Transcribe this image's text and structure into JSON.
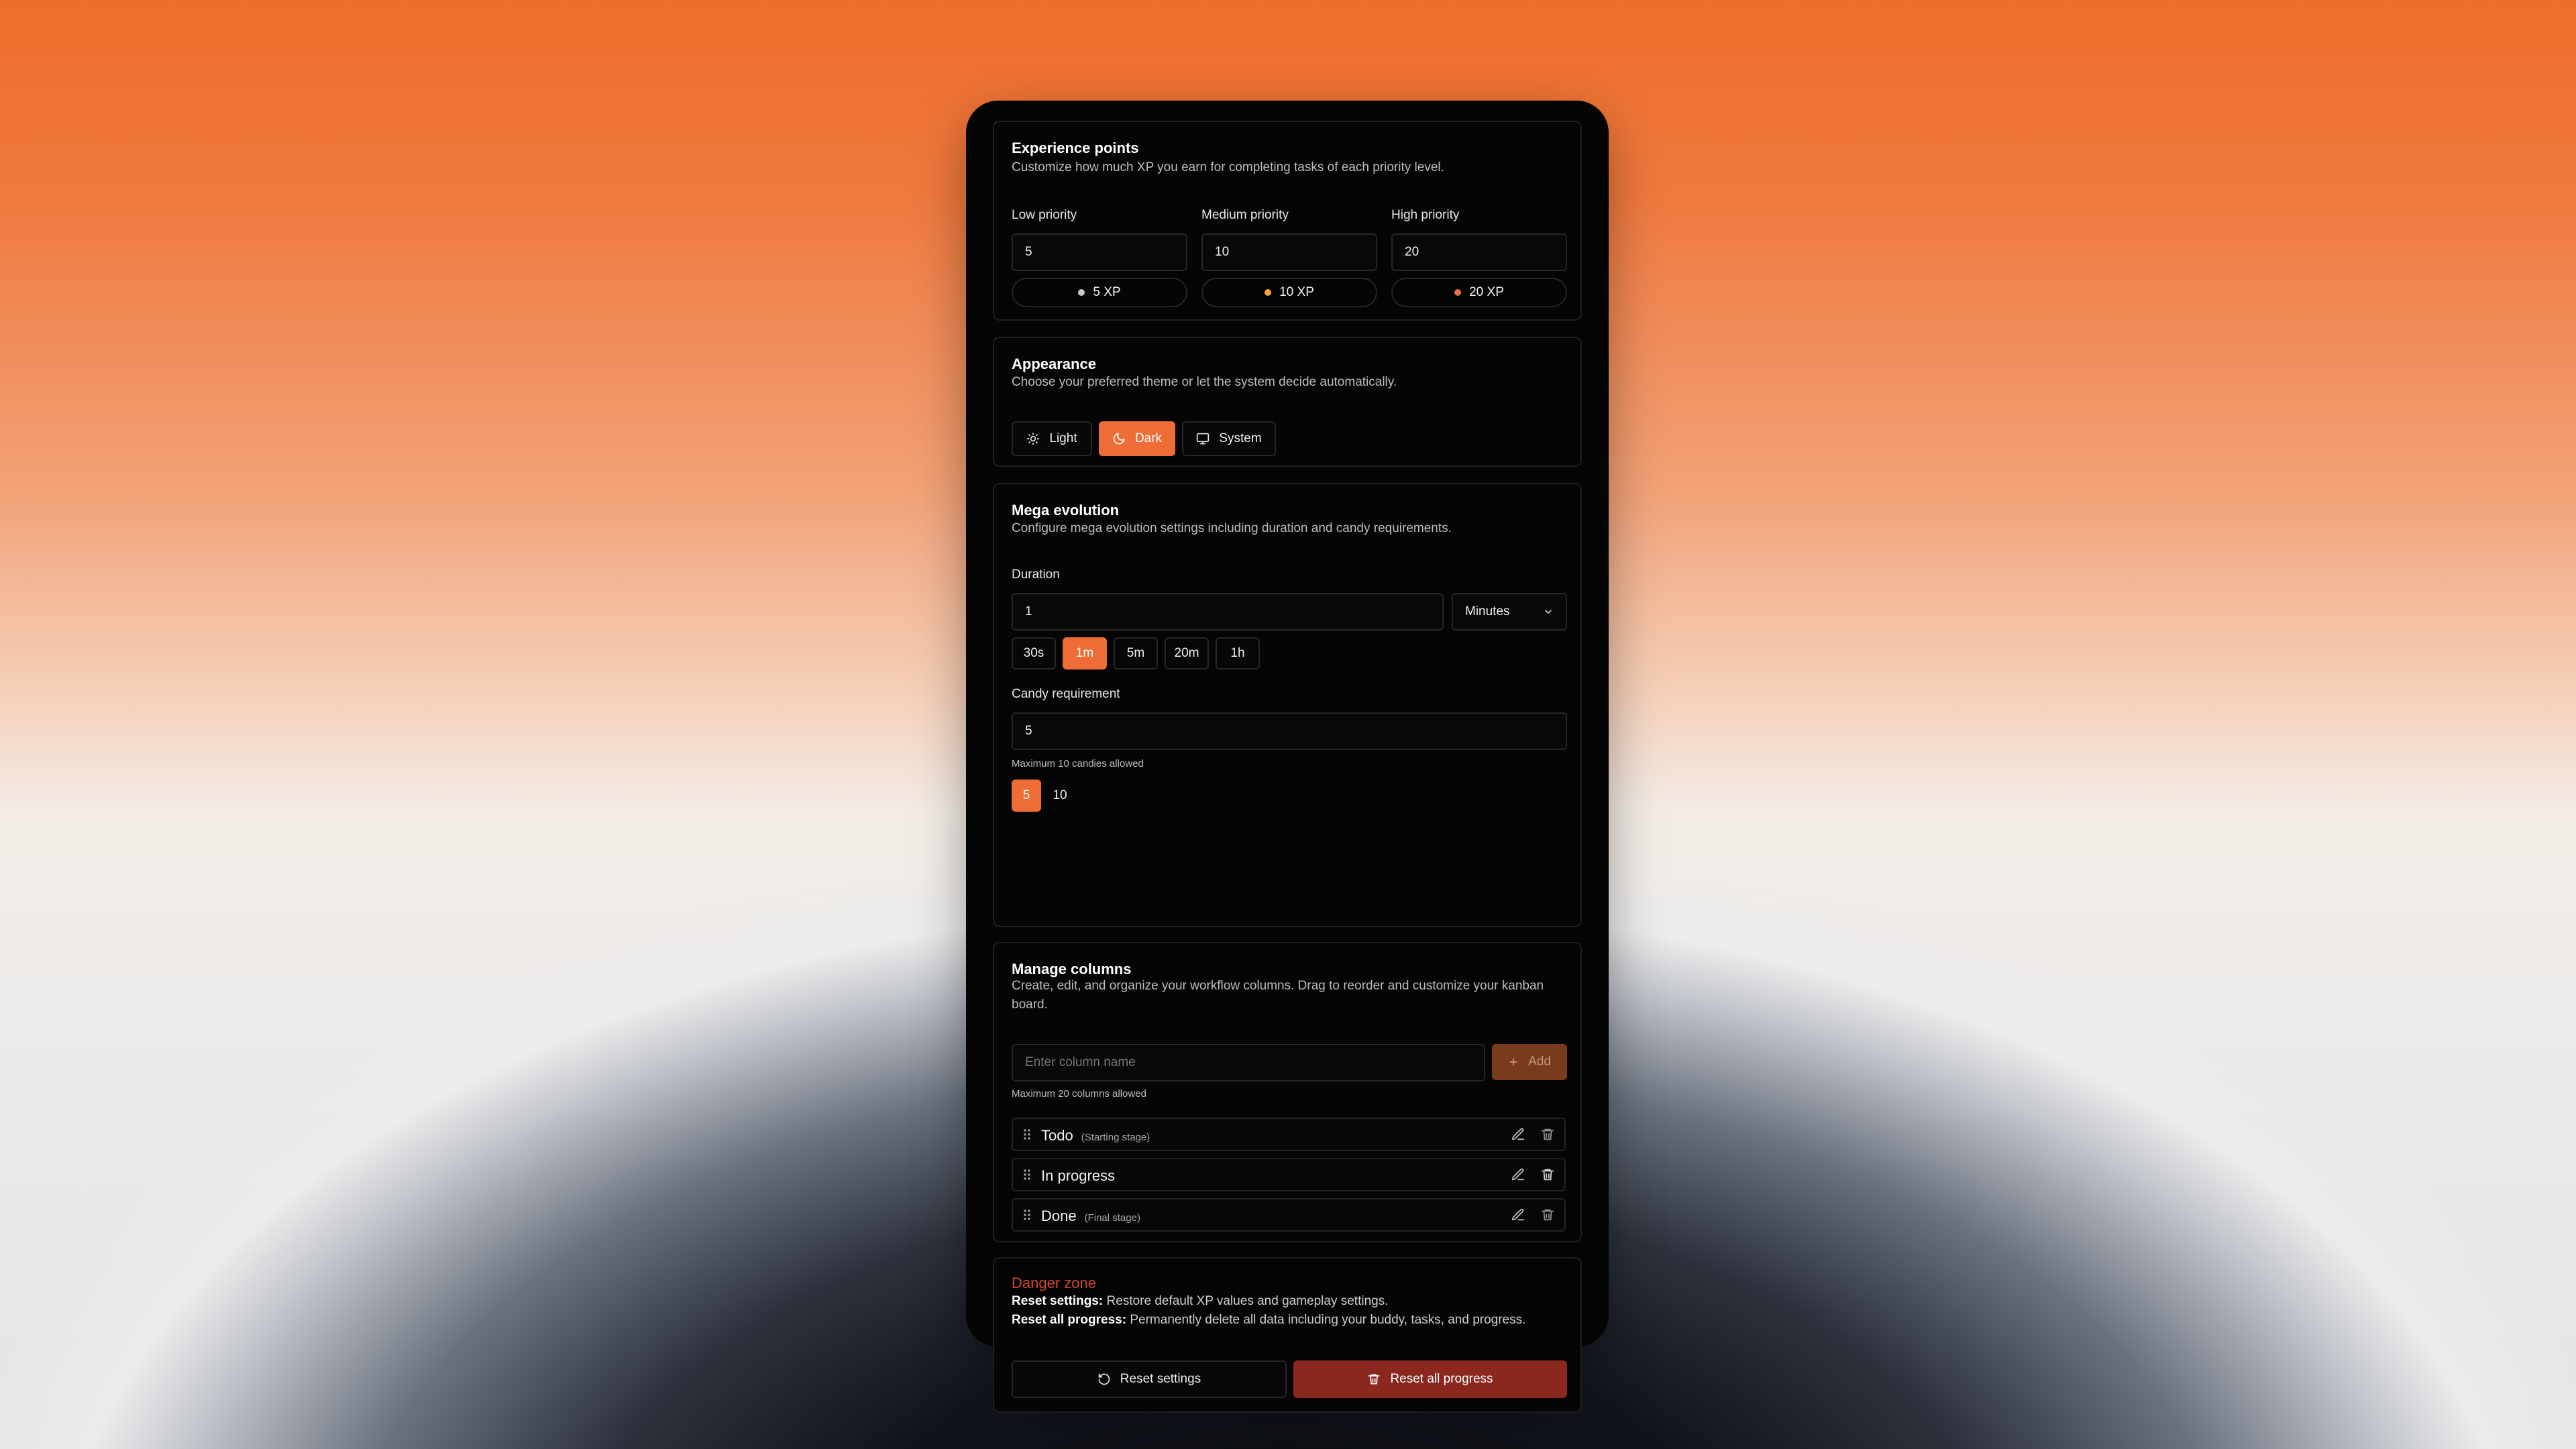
{
  "experience": {
    "title": "Experience points",
    "description": "Customize how much XP you earn for completing tasks of each priority level.",
    "low": {
      "label": "Low priority",
      "value": "5",
      "badge": "5 XP",
      "dot_color": "#c8c8c8"
    },
    "medium": {
      "label": "Medium priority",
      "value": "10",
      "badge": "10 XP",
      "dot_color": "#f3a33a"
    },
    "high": {
      "label": "High priority",
      "value": "20",
      "badge": "20 XP",
      "dot_color": "#ee6d36"
    }
  },
  "appearance": {
    "title": "Appearance",
    "description": "Choose your preferred theme or let the system decide automatically.",
    "options": [
      {
        "label": "Light",
        "icon": "sun-icon",
        "active": false
      },
      {
        "label": "Dark",
        "icon": "moon-icon",
        "active": true
      },
      {
        "label": "System",
        "icon": "monitor-icon",
        "active": false
      }
    ]
  },
  "mega": {
    "title": "Mega evolution",
    "description": "Configure mega evolution settings including duration and candy requirements.",
    "duration_label": "Duration",
    "duration_value": "1",
    "unit": "Minutes",
    "presets": [
      {
        "label": "30s",
        "active": false
      },
      {
        "label": "1m",
        "active": true
      },
      {
        "label": "5m",
        "active": false
      },
      {
        "label": "20m",
        "active": false
      },
      {
        "label": "1h",
        "active": false
      }
    ],
    "candy_label": "Candy requirement",
    "candy_value": "5",
    "candy_hint": "Maximum 10 candies allowed",
    "candy_presets": [
      {
        "label": "5",
        "active": true
      },
      {
        "label": "10",
        "active": false
      }
    ]
  },
  "columns": {
    "title": "Manage columns",
    "description": "Create, edit, and organize your workflow columns. Drag to reorder and customize your kanban board.",
    "input_placeholder": "Enter column name",
    "add_label": "Add",
    "hint": "Maximum 20 columns allowed",
    "items": [
      {
        "name": "Todo",
        "note": "(Starting stage)"
      },
      {
        "name": "In progress",
        "note": ""
      },
      {
        "name": "Done",
        "note": "(Final stage)"
      }
    ]
  },
  "danger": {
    "title": "Danger zone",
    "reset_settings_term": "Reset settings:",
    "reset_settings_text": " Restore default XP values and gameplay settings.",
    "reset_all_term": "Reset all progress:",
    "reset_all_text": " Permanently delete all data including your buddy, tasks, and progress.",
    "reset_settings_button": "Reset settings",
    "reset_all_button": "Reset all progress"
  },
  "colors": {
    "accent": "#ee6d36",
    "danger_text": "#d2462f",
    "danger_button": "#8a2820",
    "add_button": "#7a3a1e"
  }
}
